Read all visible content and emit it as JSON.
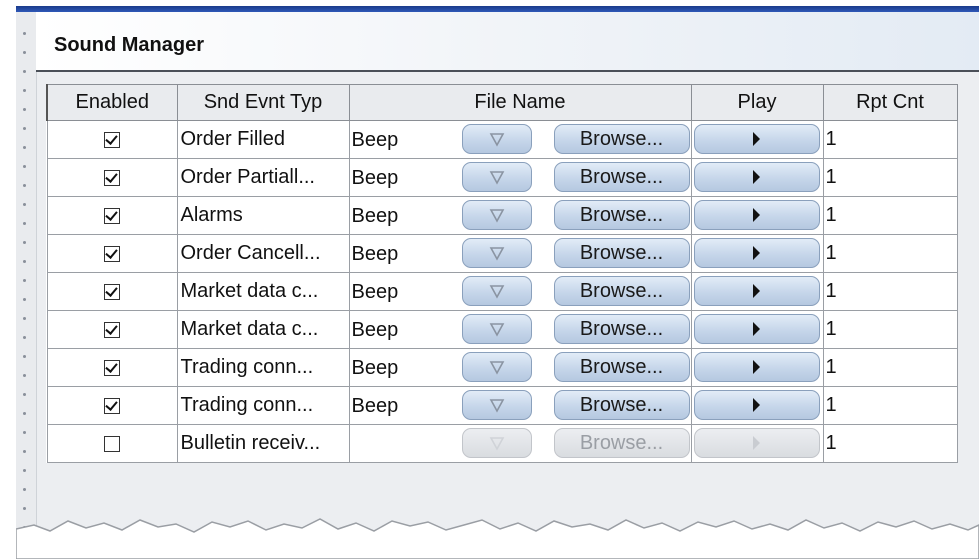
{
  "window": {
    "title": "Sound Manager"
  },
  "table": {
    "columns": [
      "Enabled",
      "Snd Evnt Typ",
      "File Name",
      "Play",
      "Rpt Cnt"
    ],
    "browse_label": "Browse...",
    "rows": [
      {
        "enabled": true,
        "event": "Order Filled",
        "file": "Beep",
        "rpt": "1"
      },
      {
        "enabled": true,
        "event": "Order Partiall...",
        "file": "Beep",
        "rpt": "1"
      },
      {
        "enabled": true,
        "event": "Alarms",
        "file": "Beep",
        "rpt": "1"
      },
      {
        "enabled": true,
        "event": "Order Cancell...",
        "file": "Beep",
        "rpt": "1"
      },
      {
        "enabled": true,
        "event": "Market data c...",
        "file": "Beep",
        "rpt": "1"
      },
      {
        "enabled": true,
        "event": "Market data c...",
        "file": "Beep",
        "rpt": "1"
      },
      {
        "enabled": true,
        "event": "Trading conn...",
        "file": "Beep",
        "rpt": "1"
      },
      {
        "enabled": true,
        "event": "Trading conn...",
        "file": "Beep",
        "rpt": "1"
      },
      {
        "enabled": false,
        "event": "Bulletin receiv...",
        "file": "",
        "rpt": "1"
      }
    ]
  },
  "icons": {
    "dropdown": "chevron-down-icon",
    "play": "play-icon",
    "check": "check-icon"
  },
  "colors": {
    "accent_bar": "#1a3a8a",
    "button_fill": "#c6d6ea",
    "button_border": "#8aa0bc"
  }
}
